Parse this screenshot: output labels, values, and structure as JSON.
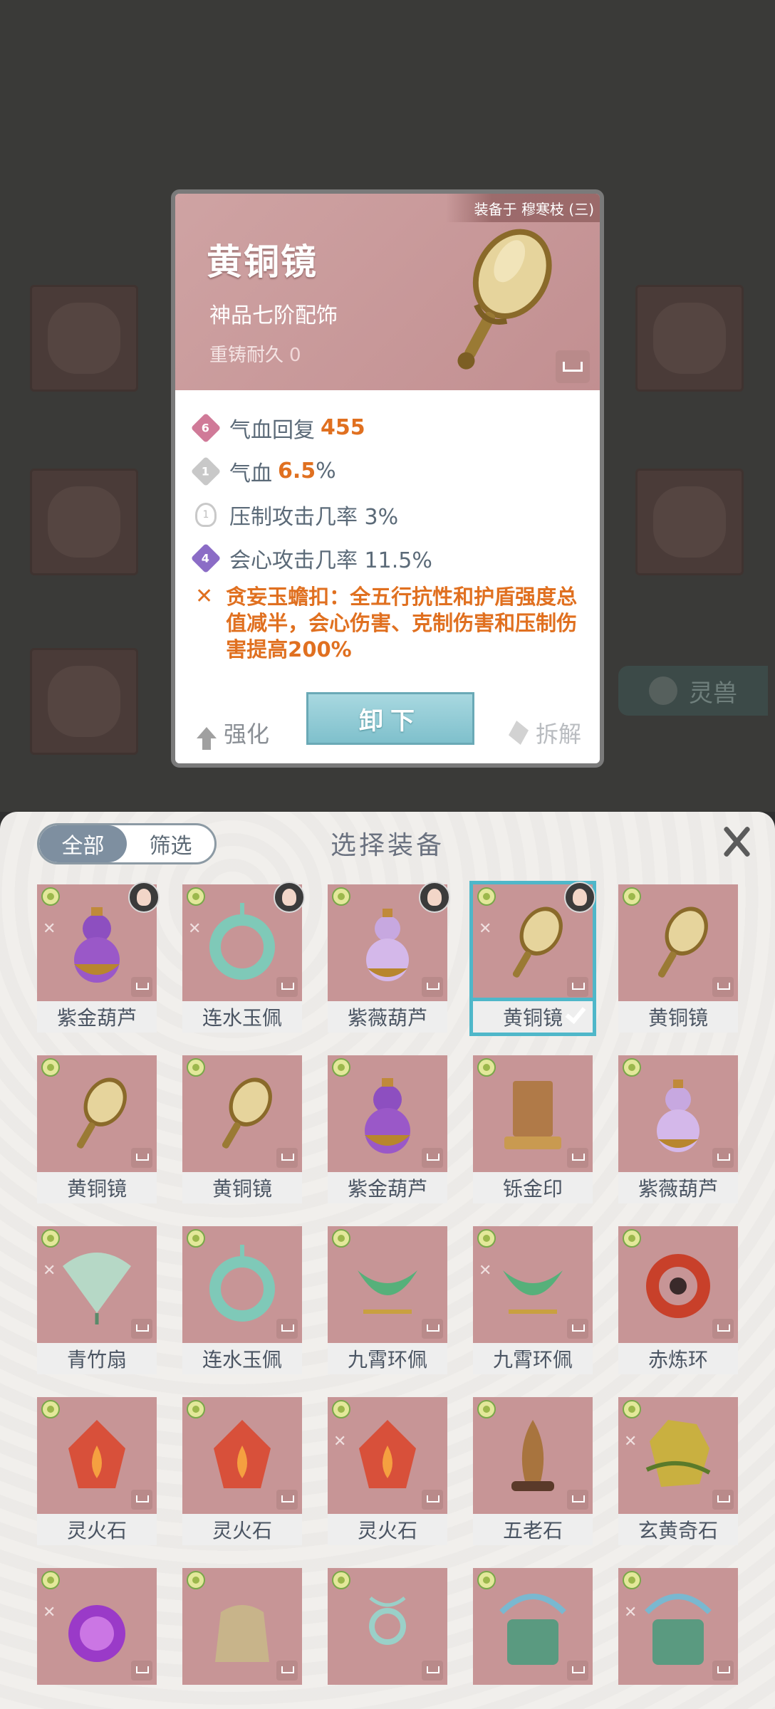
{
  "detail": {
    "equipped_on": "装备于 穆寒枝 (三)",
    "name": "黄铜镜",
    "grade": "神品七阶配饰",
    "reforge_label": "重铸耐久",
    "reforge_value": "0",
    "stats": [
      {
        "badge": "6",
        "label": "气血回复",
        "value": "455",
        "suffix": "",
        "badge_color": "#d07a98"
      },
      {
        "badge": "1",
        "label": "气血",
        "value": "6.5",
        "suffix": "%",
        "badge_color": "#c8c8c8"
      },
      {
        "badge": "1",
        "label": "压制攻击几率 3%",
        "value": "",
        "suffix": "",
        "badge_color": "#c9c9c9"
      },
      {
        "badge": "4",
        "label": "会心攻击几率 11.5%",
        "value": "",
        "suffix": "",
        "badge_color": "#8b6cc6"
      }
    ],
    "set_bonus": "贪妄玉蟾扣：全五行抗性和护盾强度总值减半，会心伤害、克制伤害和压制伤害提高200%",
    "buttons": {
      "strengthen": "强化",
      "unequip": "卸下",
      "dismantle": "拆解"
    }
  },
  "background": {
    "tab_label": "灵兽"
  },
  "panel": {
    "filter_all": "全部",
    "filter_screen": "筛选",
    "title": "选择装备",
    "items": [
      {
        "name": "紫金葫芦",
        "kind": "gourd-purple",
        "avatar": true,
        "cross": true,
        "selected": false
      },
      {
        "name": "连水玉佩",
        "kind": "jade-ring",
        "avatar": true,
        "cross": true,
        "selected": false
      },
      {
        "name": "紫薇葫芦",
        "kind": "gourd-lilac",
        "avatar": true,
        "cross": false,
        "selected": false
      },
      {
        "name": "黄铜镜",
        "kind": "mirror",
        "avatar": true,
        "cross": true,
        "selected": true
      },
      {
        "name": "黄铜镜",
        "kind": "mirror",
        "avatar": false,
        "cross": false,
        "selected": false
      },
      {
        "name": "黄铜镜",
        "kind": "mirror",
        "avatar": false,
        "cross": false,
        "selected": false
      },
      {
        "name": "黄铜镜",
        "kind": "mirror",
        "avatar": false,
        "cross": false,
        "selected": false
      },
      {
        "name": "紫金葫芦",
        "kind": "gourd-purple",
        "avatar": false,
        "cross": false,
        "selected": false
      },
      {
        "name": "铄金印",
        "kind": "seal",
        "avatar": false,
        "cross": false,
        "selected": false
      },
      {
        "name": "紫薇葫芦",
        "kind": "gourd-lilac",
        "avatar": false,
        "cross": false,
        "selected": false
      },
      {
        "name": "青竹扇",
        "kind": "fan",
        "avatar": false,
        "cross": true,
        "selected": false
      },
      {
        "name": "连水玉佩",
        "kind": "jade-ring",
        "avatar": false,
        "cross": false,
        "selected": false
      },
      {
        "name": "九霄环佩",
        "kind": "crescent",
        "avatar": false,
        "cross": false,
        "selected": false
      },
      {
        "name": "九霄环佩",
        "kind": "crescent",
        "avatar": false,
        "cross": true,
        "selected": false
      },
      {
        "name": "赤炼环",
        "kind": "red-ring",
        "avatar": false,
        "cross": false,
        "selected": false
      },
      {
        "name": "灵火石",
        "kind": "fire-stone",
        "avatar": false,
        "cross": false,
        "selected": false
      },
      {
        "name": "灵火石",
        "kind": "fire-stone",
        "avatar": false,
        "cross": false,
        "selected": false
      },
      {
        "name": "灵火石",
        "kind": "fire-stone",
        "avatar": false,
        "cross": true,
        "selected": false
      },
      {
        "name": "五老石",
        "kind": "old-stone",
        "avatar": false,
        "cross": false,
        "selected": false
      },
      {
        "name": "玄黄奇石",
        "kind": "gold-stone",
        "avatar": false,
        "cross": true,
        "selected": false
      },
      {
        "name": "",
        "kind": "orb",
        "avatar": false,
        "cross": true,
        "selected": false
      },
      {
        "name": "",
        "kind": "bag",
        "avatar": false,
        "cross": false,
        "selected": false
      },
      {
        "name": "",
        "kind": "charm",
        "avatar": false,
        "cross": false,
        "selected": false
      },
      {
        "name": "",
        "kind": "drum",
        "avatar": false,
        "cross": false,
        "selected": false
      },
      {
        "name": "",
        "kind": "drum",
        "avatar": false,
        "cross": true,
        "selected": false
      }
    ]
  },
  "colors": {
    "accent": "#e07020",
    "select_border": "#4fb7c9",
    "tile_bg": "#c79596",
    "unequip_btn": "#7fc0cc"
  }
}
